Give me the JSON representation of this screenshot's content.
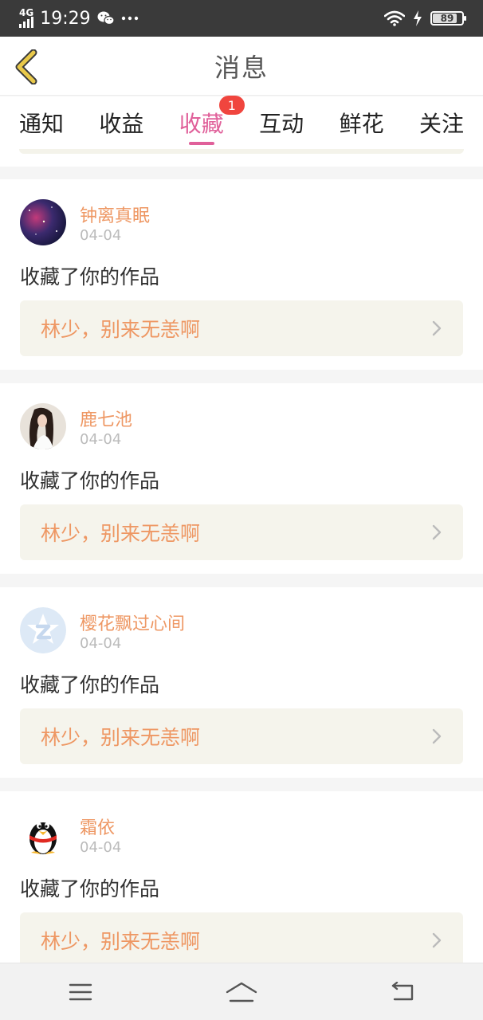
{
  "status_bar": {
    "network": "4G",
    "time": "19:29",
    "battery": "89",
    "icons": [
      "signal-icon",
      "wechat-icon",
      "more-icon",
      "wifi-icon",
      "charging-icon",
      "battery-icon"
    ]
  },
  "header": {
    "title": "消息",
    "back_icon": "chevron-left-icon"
  },
  "tabs": [
    {
      "label": "通知"
    },
    {
      "label": "收益"
    },
    {
      "label": "收藏",
      "badge": "1",
      "active": true
    },
    {
      "label": "互动"
    },
    {
      "label": "鲜花"
    },
    {
      "label": "关注"
    }
  ],
  "cards": [
    {
      "username": "钟离真眠",
      "date": "04-04",
      "action": "收藏了你的作品",
      "work_title": "林少，别来无恙啊"
    },
    {
      "username": "鹿七池",
      "date": "04-04",
      "action": "收藏了你的作品",
      "work_title": "林少，别来无恙啊"
    },
    {
      "username": "樱花飘过心间",
      "date": "04-04",
      "action": "收藏了你的作品",
      "work_title": "林少，别来无恙啊"
    },
    {
      "username": "霜依",
      "date": "04-04",
      "action": "收藏了你的作品",
      "work_title": "林少，别来无恙啊"
    }
  ],
  "bottom_nav": [
    "menu-icon",
    "home-icon",
    "back-icon"
  ],
  "colors": {
    "accent": "#e0609a",
    "badge": "#f0453e",
    "username": "#ee9763",
    "work_bg": "#f5f4ec"
  }
}
